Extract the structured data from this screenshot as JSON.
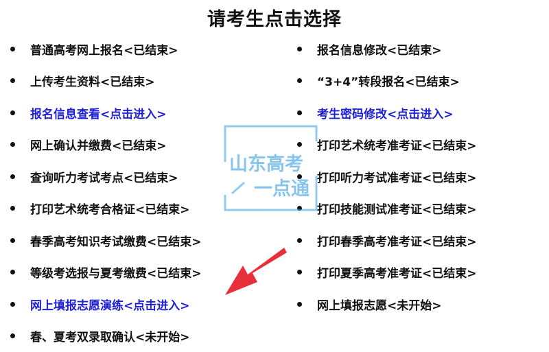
{
  "page": {
    "title": "请考生点击选择"
  },
  "left_items": [
    {
      "label": "普通高考网上报名<已结束>",
      "link": false
    },
    {
      "label": "上传考生资料<已结束>",
      "link": false
    },
    {
      "label": "报名信息查看<点击进入>",
      "link": true
    },
    {
      "label": "网上确认并缴费<已结束>",
      "link": false
    },
    {
      "label": "查询听力考试考点<已结束>",
      "link": false
    },
    {
      "label": "打印艺术统考合格证<已结束>",
      "link": false
    },
    {
      "label": "春季高考知识考试缴费<已结束>",
      "link": false
    },
    {
      "label": "等级考选报与夏考缴费<已结束>",
      "link": false
    },
    {
      "label": "网上填报志愿演练<点击进入>",
      "link": true
    },
    {
      "label": "春、夏考双录取确认<未开始>",
      "link": false
    }
  ],
  "right_items": [
    {
      "label": "报名信息修改<已结束>",
      "link": false
    },
    {
      "label": "“3+4”转段报名<已结束>",
      "link": false
    },
    {
      "label": "考生密码修改<点击进入>",
      "link": true
    },
    {
      "label": "打印艺术统考准考证<已结束>",
      "link": false
    },
    {
      "label": "打印听力考试准考证<已结束>",
      "link": false
    },
    {
      "label": "打印技能测试准考证<已结束>",
      "link": false
    },
    {
      "label": "打印春季高考准考证<已结束>",
      "link": false
    },
    {
      "label": "打印夏季高考准考证<已结束>",
      "link": false
    },
    {
      "label": "网上填报志愿<未开始>",
      "link": false
    }
  ],
  "watermark": {
    "line1": "山东高考",
    "line2": "一点通"
  },
  "colors": {
    "link": "#1f1fd6",
    "text": "#111111",
    "arrow": "#e8303a",
    "watermark": "#3aa0e0"
  }
}
